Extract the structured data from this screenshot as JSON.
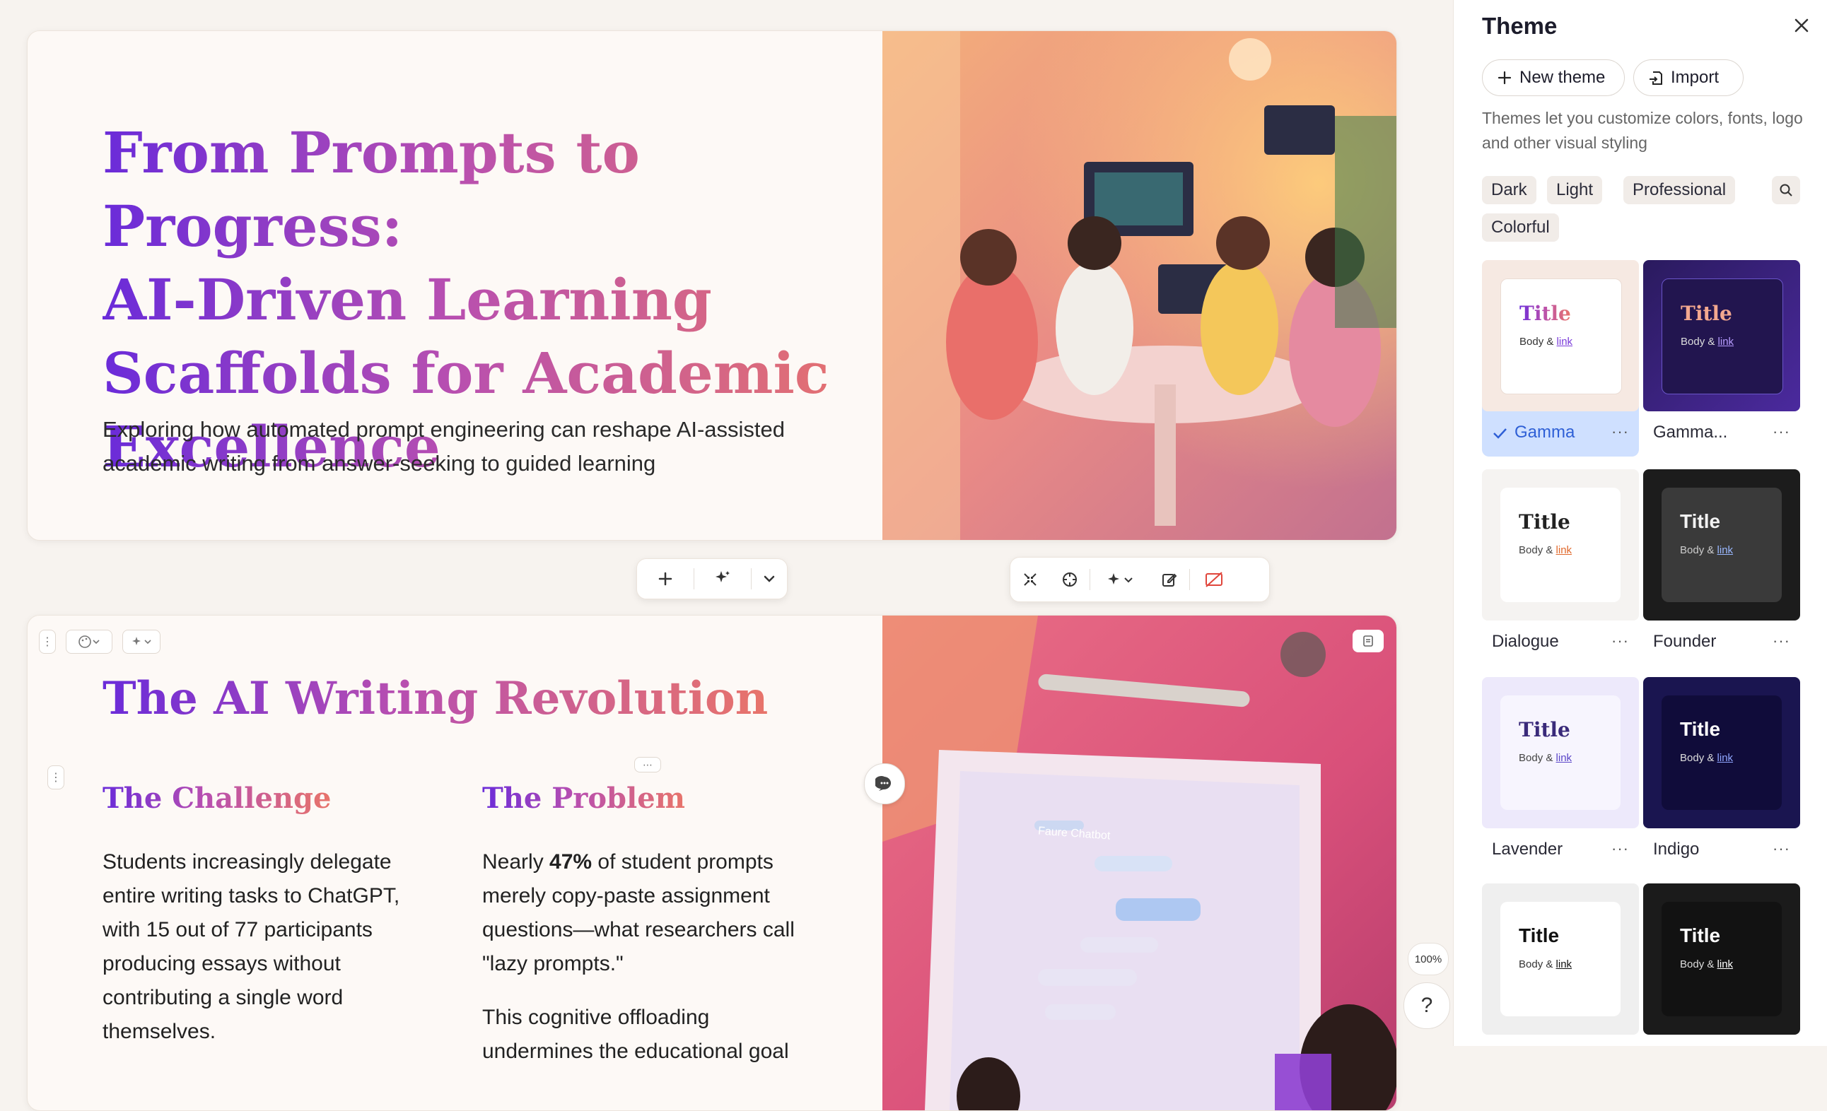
{
  "slide1": {
    "title_lines": [
      "From Prompts to Progress:",
      "AI-Driven Learning",
      "Scaffolds for Academic",
      "Excellence"
    ],
    "subtitle": "Exploring how automated prompt engineering can reshape AI-assisted academic writing from answer-seeking to guided learning"
  },
  "slide2": {
    "title": "The AI Writing Revolution",
    "col1": {
      "heading": "The Challenge",
      "body": "Students increasingly delegate entire writing tasks to ChatGPT, with 15 out of 77 participants producing essays without contributing a single word themselves."
    },
    "col2": {
      "heading": "The Problem",
      "body_pre": "Nearly ",
      "body_bold": "47%",
      "body_post": " of student prompts merely copy-paste assignment questions—what researchers call \"lazy prompts.\"",
      "body2": "This cognitive offloading undermines the educational goal"
    },
    "screen_label": "Faure Chatbot"
  },
  "zoom": "100%",
  "help": "?",
  "panel": {
    "title": "Theme",
    "new_theme": "New theme",
    "import": "Import",
    "description": "Themes let you customize colors, fonts, logo and other visual styling",
    "filters": [
      "Dark",
      "Light",
      "Professional",
      "Colorful"
    ],
    "themes": [
      {
        "name": "Gamma",
        "title": "Title",
        "body": "Body & ",
        "link": "link",
        "selected": true
      },
      {
        "name": "Gamma...",
        "title": "Title",
        "body": "Body & ",
        "link": "link"
      },
      {
        "name": "Dialogue",
        "title": "Title",
        "body": "Body & ",
        "link": "link"
      },
      {
        "name": "Founder",
        "title": "Title",
        "body": "Body & ",
        "link": "link"
      },
      {
        "name": "Lavender",
        "title": "Title",
        "body": "Body & ",
        "link": "link"
      },
      {
        "name": "Indigo",
        "title": "Title",
        "body": "Body & ",
        "link": "link"
      },
      {
        "name": "",
        "title": "Title",
        "body": "Body & ",
        "link": "link"
      },
      {
        "name": "",
        "title": "Title",
        "body": "Body & ",
        "link": "link"
      }
    ]
  }
}
